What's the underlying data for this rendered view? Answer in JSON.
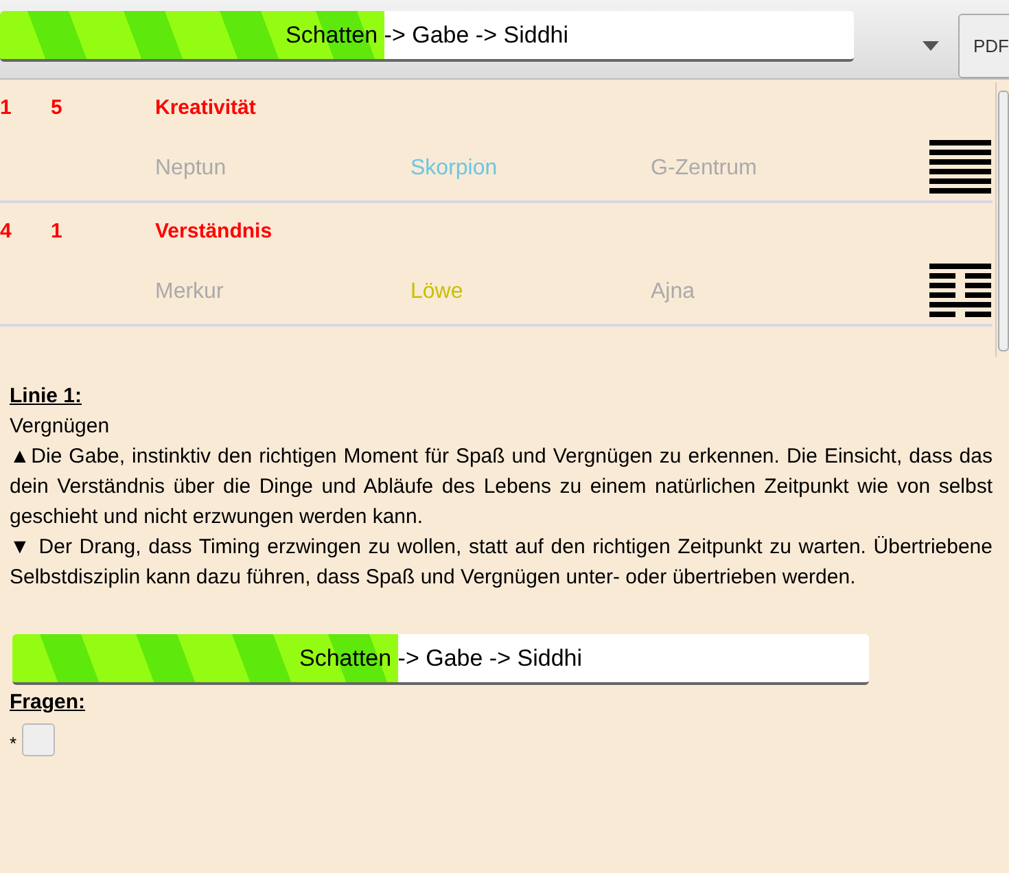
{
  "top_bar": {
    "label": "Schatten -> Gabe -> Siddhi",
    "level": 0.45
  },
  "pdf_button": "PDF",
  "gates": [
    {
      "line": "1",
      "gate": "5",
      "title": "Kreativität",
      "planet": "Neptun",
      "sign": "Skorpion",
      "color": "#6cc6e2",
      "center": "G-Zentrum",
      "hexagram": [
        {
          "broken": false
        },
        {
          "broken": false
        },
        {
          "broken": false
        },
        {
          "broken": false
        },
        {
          "broken": false
        },
        {
          "broken": false
        }
      ]
    },
    {
      "line": "4",
      "gate": "1",
      "title": "Verständnis",
      "planet": "Merkur",
      "sign": "Löwe",
      "color": "#c8c000",
      "center": "Ajna",
      "hexagram": [
        {
          "broken": false
        },
        {
          "broken": true
        },
        {
          "broken": true
        },
        {
          "broken": true
        },
        {
          "broken": false
        },
        {
          "broken": true
        }
      ]
    }
  ],
  "line_heading": "Linie 1:",
  "line_name": "Vergnügen",
  "paragraphs": [
    "▲Die Gabe, instinktiv den richtigen Moment für Spaß und Vergnügen zu erkennen. Die Einsicht, dass das dein Verständnis über die Dinge und Abläufe des Lebens zu einem natürlichen Zeitpunkt wie von selbst geschieht und nicht erzwungen werden kann.",
    "▼ Der Drang, dass Timing erzwingen zu wollen, statt auf den richtigen Zeitpunkt zu warten. Übertriebene Selbstdisziplin kann dazu führen, dass Spaß und Vergnügen unter- oder übertrieben werden."
  ],
  "bottom_bar": {
    "label": "Schatten -> Gabe -> Siddhi",
    "level": 0.45
  },
  "questions_heading": "Fragen:",
  "bullet": "*",
  "answer_checkbox": {
    "checked": false
  }
}
